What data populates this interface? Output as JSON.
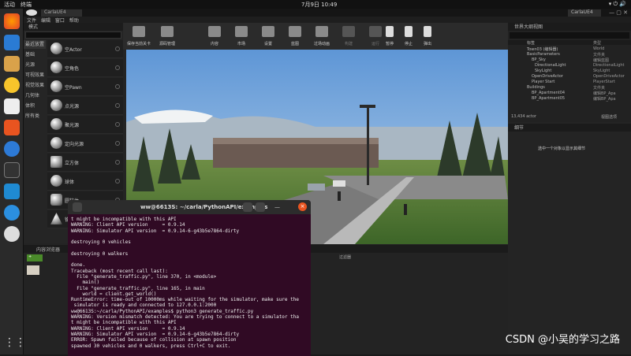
{
  "topbar": {
    "left": "活动",
    "app": "终端",
    "clock": "7月9日 10:49"
  },
  "ue": {
    "tab": "CarlaUE4",
    "right_tab": "CarlaUE4",
    "menu": [
      "文件",
      "编辑",
      "窗口",
      "帮助"
    ]
  },
  "modes": {
    "header": "模式",
    "categories": [
      "最近放置",
      "基础",
      "光源",
      "可视效果",
      "视觉效果",
      "几何体",
      "体积",
      "所有类"
    ],
    "items": [
      "空Actor",
      "空角色",
      "空Pawn",
      "点光源",
      "聚光源",
      "定向光源",
      "立方体",
      "球体",
      "圆柱体",
      "锥体",
      "平面"
    ]
  },
  "toolbar": {
    "buttons": [
      "保存当前关卡",
      "源码管理",
      "内容",
      "市场",
      "设置",
      "蓝图",
      "过场动画",
      "构建",
      "运行",
      "暂停",
      "停止",
      "弹出"
    ]
  },
  "outliner": {
    "header": "世界大纲视图",
    "col_label": "标签",
    "col_type": "类型",
    "rows": [
      {
        "name": "Town03 (编辑器)",
        "type": "World"
      },
      {
        "name": "BasicParameters",
        "type": "文件夹"
      },
      {
        "name": "BP_Sky",
        "type": "编辑蓝图"
      },
      {
        "name": "DirectionalLight",
        "type": "DirectionalLight"
      },
      {
        "name": "SkyLight",
        "type": "SkyLight"
      },
      {
        "name": "OpenDriveActor",
        "type": "OpenDriveActor"
      },
      {
        "name": "Player Start",
        "type": "PlayerStart"
      },
      {
        "name": "Buildings",
        "type": "文件夹"
      },
      {
        "name": "BP_Apartment04",
        "type": "编辑BP_Apa"
      },
      {
        "name": "BP_Apartment05",
        "type": "编辑BP_Apa"
      }
    ],
    "footer": "13,434 actor",
    "footer_right": "视图选项"
  },
  "details": {
    "header": "细节",
    "message": "选中一个对象以显示其细节"
  },
  "content": {
    "header": "内容浏览器",
    "filter": "过滤器"
  },
  "terminal": {
    "title": "ww@6613S: ~/carla/PythonAPI/examples",
    "lines": [
      "t might be incompatible with this API",
      "WARNING: Client API version     = 0.9.14",
      "WARNING: Simulator API version  = 0.9.14-6-g43b5e7864-dirty",
      "",
      "destroying 0 vehicles",
      "",
      "destroying 0 walkers",
      "",
      "done.",
      "Traceback (most recent call last):",
      "  File \"generate_traffic.py\", line 370, in <module>",
      "    main()",
      "  File \"generate_traffic.py\", line 165, in main",
      "    world = client.get_world()",
      "RuntimeError: time-out of 10000ms while waiting for the simulator, make sure the",
      " simulator is ready and connected to 127.0.0.1:2000",
      "ww@6613S:~/carla/PythonAPI/examples$ python3 generate_traffic.py",
      "WARNING: Version mismatch detected: You are trying to connect to a simulator tha",
      "t might be incompatible with this API",
      "WARNING: Client API version     = 0.9.14",
      "WARNING: Simulator API version  = 0.9.14-6-g43b5e7864-dirty",
      "ERROR: Spawn failed because of collision at spawn position",
      "spawned 30 vehicles and 0 walkers, press Ctrl+C to exit."
    ]
  },
  "watermark": "CSDN @小吴的学习之路"
}
